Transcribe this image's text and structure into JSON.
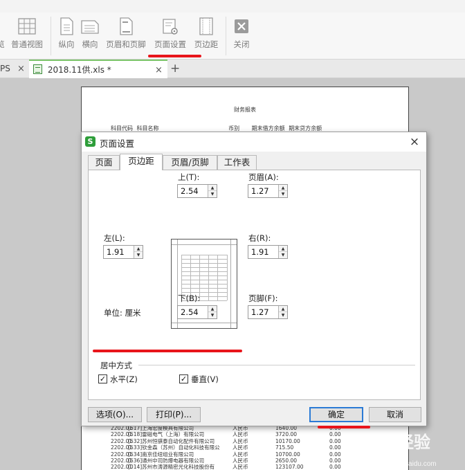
{
  "toolbar": {
    "items": [
      {
        "label": "览",
        "icon": "print-preview-icon"
      },
      {
        "label": "普通视图",
        "icon": "normal-view-icon"
      },
      {
        "label": "纵向",
        "icon": "portrait-icon"
      },
      {
        "label": "横向",
        "icon": "landscape-icon"
      },
      {
        "label": "页眉和页脚",
        "icon": "header-footer-icon"
      },
      {
        "label": "页面设置",
        "icon": "page-setup-icon"
      },
      {
        "label": "页边距",
        "icon": "page-margins-icon"
      },
      {
        "label": "关闭",
        "icon": "close-icon"
      }
    ]
  },
  "tabs": {
    "tab1": "PS",
    "tab2": "2018.11供.xls *",
    "close": "×",
    "add": "+"
  },
  "sheet": {
    "title": "财务报表",
    "headers": [
      "科目代码",
      "科目名称",
      "币别",
      "期末借方余额",
      "期末贷方余额"
    ],
    "rows": [
      {
        "code": "2202.01",
        "name": "[617]上海宏度模具有限公司",
        "cur": "人民币",
        "debit": "1640.00",
        "credit": "0.00"
      },
      {
        "code": "2202.01",
        "name": "[618]雷磁电气（上海）有限公司",
        "cur": "人民币",
        "debit": "3720.00",
        "credit": "0.00"
      },
      {
        "code": "2202.01",
        "name": "[632]苏州恒骐泰自动化配件有限公司",
        "cur": "人民币",
        "debit": "10170.00",
        "credit": "0.00"
      },
      {
        "code": "2202.01",
        "name": "[633]钦金森（苏州）自动化科技有限公",
        "cur": "人民币",
        "debit": "715.50",
        "credit": "0.00"
      },
      {
        "code": "2202.01",
        "name": "[634]南京佳纽组业有限公司",
        "cur": "人民币",
        "debit": "10700.00",
        "credit": "0.00"
      },
      {
        "code": "2202.01",
        "name": "[636]通州中司防爆电器有限公司",
        "cur": "人民币",
        "debit": "2650.00",
        "credit": "0.00"
      },
      {
        "code": "2202.01",
        "name": "[014]苏州市涛源精密光化科技股份有",
        "cur": "人民币",
        "debit": "123107.00",
        "credit": "0.00"
      }
    ]
  },
  "dialog": {
    "title": "页面设置",
    "logo": "S",
    "close": "×",
    "tabs": [
      "页面",
      "页边距",
      "页眉/页脚",
      "工作表"
    ],
    "active_tab": "页边距",
    "fields": {
      "top": {
        "label": "上(T):",
        "value": "2.54"
      },
      "header": {
        "label": "页眉(A):",
        "value": "1.27"
      },
      "left": {
        "label": "左(L):",
        "value": "1.91"
      },
      "right": {
        "label": "右(R):",
        "value": "1.91"
      },
      "bottom": {
        "label": "下(B):",
        "value": "2.54"
      },
      "footer": {
        "label": "页脚(F):",
        "value": "1.27"
      }
    },
    "unit": "单位: 厘米",
    "centering": {
      "label": "居中方式",
      "horizontal": {
        "label": "水平(Z)",
        "checked": true
      },
      "vertical": {
        "label": "垂直(V)",
        "checked": true
      }
    },
    "check_mark": "✓",
    "buttons": {
      "options": "选项(O)...",
      "print": "打印(P)...",
      "ok": "确定",
      "cancel": "取消"
    }
  },
  "watermark": {
    "brand": "Bai 经验",
    "url": "jingyan.baidu.com"
  },
  "colors": {
    "annotation_red": "#e8151b",
    "tab_accent": "#7cc56a",
    "ok_border": "#2a7ad5"
  }
}
